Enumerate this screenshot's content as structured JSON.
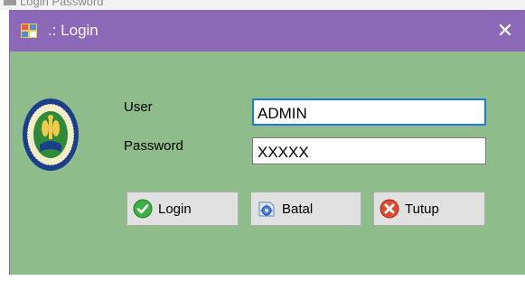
{
  "background_window": {
    "title_fragment": "Login Password"
  },
  "window": {
    "title": ".: Login",
    "close_glyph": "✕",
    "title_color": "#8b68b8",
    "body_color": "#8fbc8b"
  },
  "form": {
    "user_label": "User",
    "user_value": "ADMIN",
    "password_label": "Password",
    "password_value": "XXXXX"
  },
  "buttons": {
    "login": {
      "label": "Login",
      "icon": "check-circle-icon"
    },
    "batal": {
      "label": "Batal",
      "icon": "gear-refresh-icon"
    },
    "tutup": {
      "label": "Tutup",
      "icon": "close-circle-icon"
    }
  },
  "logo": {
    "icon": "university-seal-icon"
  }
}
